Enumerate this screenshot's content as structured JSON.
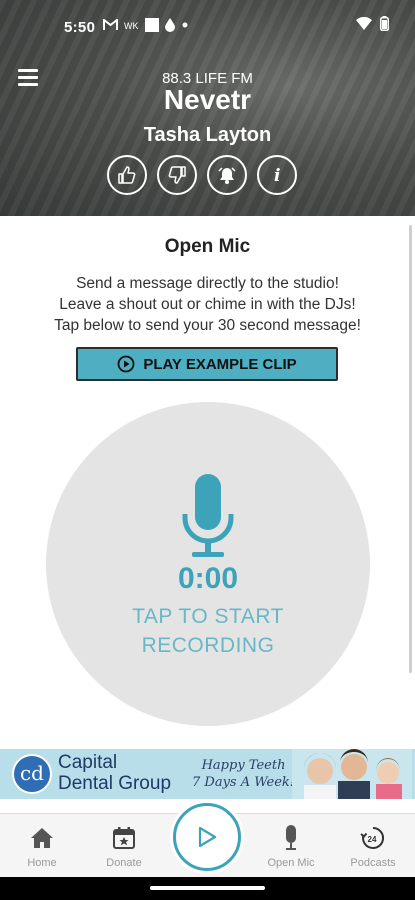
{
  "status": {
    "time": "5:50"
  },
  "player": {
    "station": "88.3 LIFE FM",
    "song": "Nevetr",
    "artist": "Tasha Layton"
  },
  "page": {
    "title": "Open Mic",
    "description_lines": [
      "Send a message directly to the studio!",
      "Leave a shout out or chime in with the DJs!",
      "Tap below to send your 30 second message!"
    ],
    "play_example_label": "PLAY EXAMPLE CLIP"
  },
  "recorder": {
    "timer": "0:00",
    "prompt_line1": "TAP TO START",
    "prompt_line2": "RECORDING"
  },
  "ad": {
    "logo": "cd",
    "name_line1": "Capital",
    "name_line2": "Dental Group",
    "tagline_line1": "Happy Teeth",
    "tagline_line2": "7 Days A Week!"
  },
  "nav": {
    "items": [
      {
        "label": "Home",
        "icon": "home-icon"
      },
      {
        "label": "Donate",
        "icon": "calendar-star-icon"
      },
      {
        "label": "Open Mic",
        "icon": "microphone-icon"
      },
      {
        "label": "Podcasts",
        "icon": "podcast-24-icon"
      }
    ]
  },
  "colors": {
    "accent": "#3da3b8",
    "button": "#4fafc2",
    "ad_bg": "#b7dee9"
  }
}
